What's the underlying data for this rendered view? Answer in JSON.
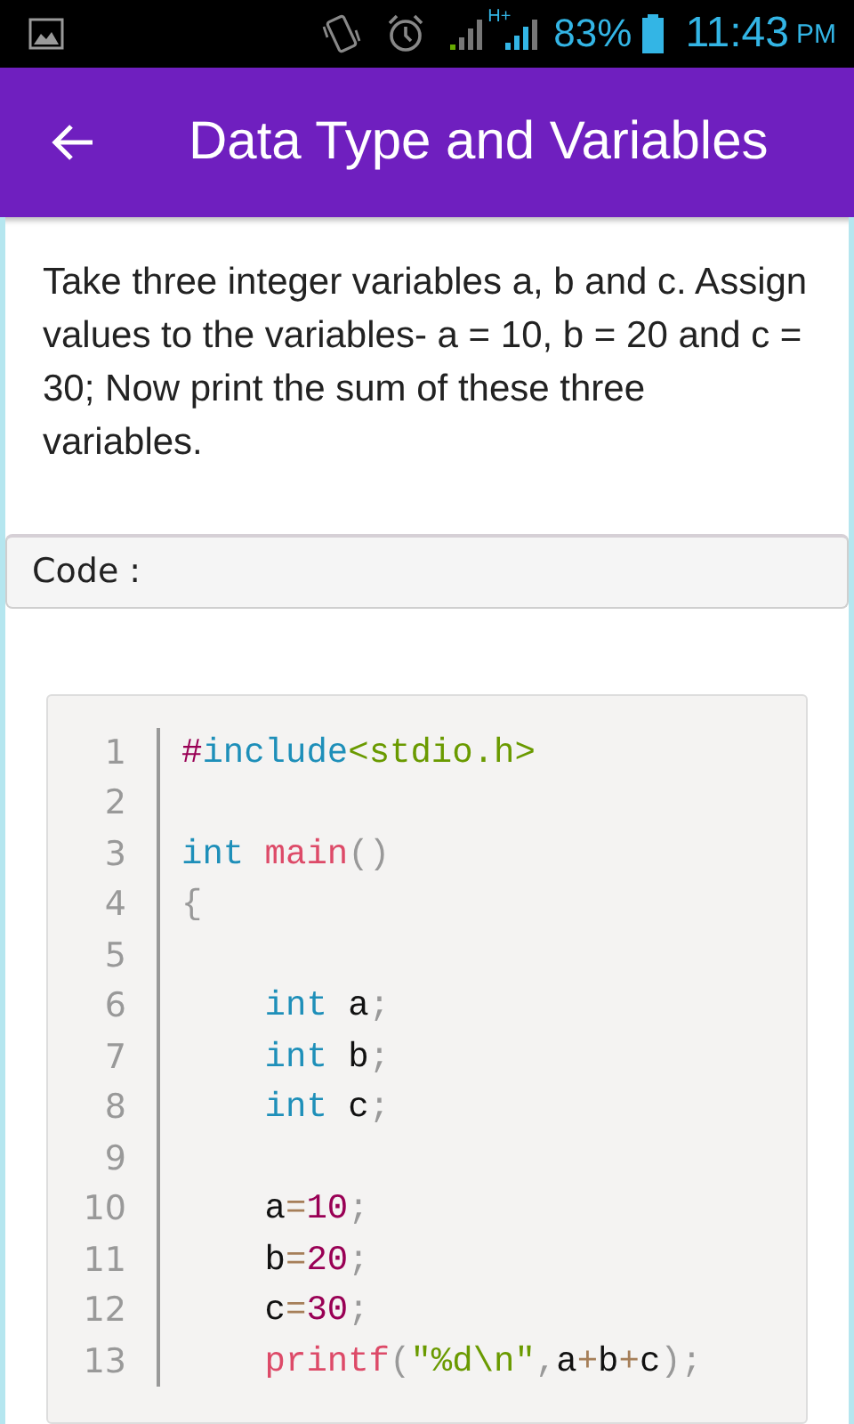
{
  "status_bar": {
    "network": "H+",
    "battery": "83%",
    "time": "11:43",
    "meridiem": "PM"
  },
  "app_bar": {
    "title": "Data Type and Variables"
  },
  "question": "Take three integer variables a, b and c. Assign values to the variables- a = 10, b = 20 and c = 30; Now print the sum of these three variables.",
  "code_header": "Code :",
  "code_lines": [
    {
      "number": "1",
      "tokens": [
        {
          "kind": "directive",
          "text": "#"
        },
        {
          "kind": "keyword",
          "text": "include"
        },
        {
          "kind": "string",
          "text": "<stdio.h>"
        }
      ]
    },
    {
      "number": "2"
    },
    {
      "number": "3",
      "tokens": [
        {
          "kind": "keyword",
          "text": "int"
        },
        {
          "kind": "function",
          "text": " main"
        },
        {
          "kind": "punct",
          "text": "()"
        }
      ]
    },
    {
      "number": "4",
      "tokens": [
        {
          "kind": "punct",
          "text": "{"
        }
      ]
    },
    {
      "number": "5"
    },
    {
      "number": "6",
      "indented": true,
      "tokens": [
        {
          "kind": "keyword",
          "text": "int"
        },
        {
          "kind": "plain",
          "text": " a"
        },
        {
          "kind": "punct",
          "text": ";"
        }
      ]
    },
    {
      "number": "7",
      "indented": true,
      "tokens": [
        {
          "kind": "keyword",
          "text": "int"
        },
        {
          "kind": "plain",
          "text": " b"
        },
        {
          "kind": "punct",
          "text": ";"
        }
      ]
    },
    {
      "number": "8",
      "indented": true,
      "tokens": [
        {
          "kind": "keyword",
          "text": "int"
        },
        {
          "kind": "plain",
          "text": " c"
        },
        {
          "kind": "punct",
          "text": ";"
        }
      ]
    },
    {
      "number": "9"
    },
    {
      "number": "10",
      "indented": true,
      "tokens": [
        {
          "kind": "plain",
          "text": "a"
        },
        {
          "kind": "operator",
          "text": "="
        },
        {
          "kind": "number",
          "text": "10"
        },
        {
          "kind": "punct",
          "text": ";"
        }
      ]
    },
    {
      "number": "11",
      "indented": true,
      "tokens": [
        {
          "kind": "plain",
          "text": "b"
        },
        {
          "kind": "operator",
          "text": "="
        },
        {
          "kind": "number",
          "text": "20"
        },
        {
          "kind": "punct",
          "text": ";"
        }
      ]
    },
    {
      "number": "12",
      "indented": true,
      "tokens": [
        {
          "kind": "plain",
          "text": "c"
        },
        {
          "kind": "operator",
          "text": "="
        },
        {
          "kind": "number",
          "text": "30"
        },
        {
          "kind": "punct",
          "text": ";"
        }
      ]
    },
    {
      "number": "13",
      "indented": true,
      "tokens": [
        {
          "kind": "function",
          "text": "printf"
        },
        {
          "kind": "punct",
          "text": "("
        },
        {
          "kind": "string",
          "text": "\"%d\\n\""
        },
        {
          "kind": "punct",
          "text": ","
        },
        {
          "kind": "plain",
          "text": "a"
        },
        {
          "kind": "operator",
          "text": "+"
        },
        {
          "kind": "plain",
          "text": "b"
        },
        {
          "kind": "operator",
          "text": "+"
        },
        {
          "kind": "plain",
          "text": "c"
        },
        {
          "kind": "punct",
          "text": ")"
        },
        {
          "kind": "punct",
          "text": ";"
        }
      ]
    }
  ]
}
